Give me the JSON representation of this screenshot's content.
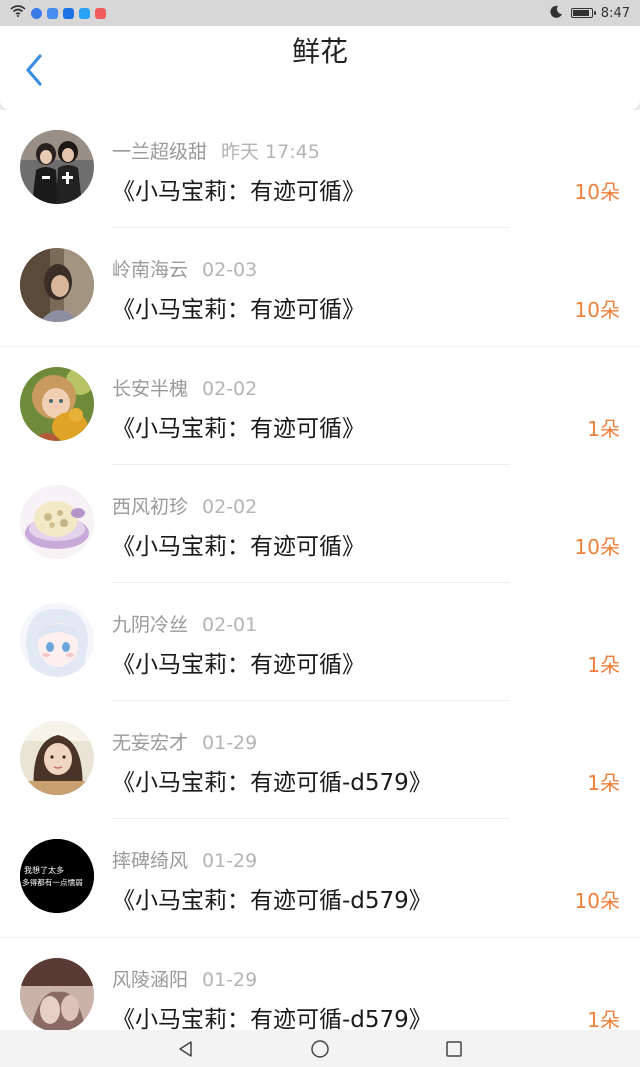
{
  "status_bar": {
    "time": "8:47",
    "icons": [
      "wifi-icon",
      "app-icon",
      "app-icon",
      "app-icon",
      "app-icon",
      "app-icon",
      "moon-icon",
      "battery-icon"
    ],
    "battery_level": 0.85
  },
  "header": {
    "title": "鲜花",
    "back_icon": "chevron-left-icon",
    "accent": "#3a8ee6"
  },
  "rows": [
    {
      "user": "一兰超级甜",
      "time": "昨天 17:45",
      "book": "《小马宝莉：有迹可循》",
      "count": "10朵"
    },
    {
      "user": "岭南海云",
      "time": "02-03",
      "book": "《小马宝莉：有迹可循》",
      "count": "10朵"
    },
    {
      "user": "长安半槐",
      "time": "02-02",
      "book": "《小马宝莉：有迹可循》",
      "count": "1朵"
    },
    {
      "user": "西风初珍",
      "time": "02-02",
      "book": "《小马宝莉：有迹可循》",
      "count": "10朵"
    },
    {
      "user": "九阴冷丝",
      "time": "02-01",
      "book": "《小马宝莉：有迹可循》",
      "count": "1朵"
    },
    {
      "user": "无妄宏才",
      "time": "01-29",
      "book": "《小马宝莉：有迹可循-d579》",
      "count": "1朵"
    },
    {
      "user": "摔碑绮风",
      "time": "01-29",
      "book": "《小马宝莉：有迹可循-d579》",
      "count": "10朵"
    },
    {
      "user": "风陵涵阳",
      "time": "01-29",
      "book": "《小马宝莉：有迹可循-d579》",
      "count": "1朵"
    }
  ],
  "avatar_7_text": [
    "我想了太多",
    "多得都有一点懦弱"
  ],
  "count_color": "#ef7f3a",
  "nav_bar": {
    "icons": [
      "back-triangle-icon",
      "home-circle-icon",
      "recents-square-icon"
    ]
  }
}
